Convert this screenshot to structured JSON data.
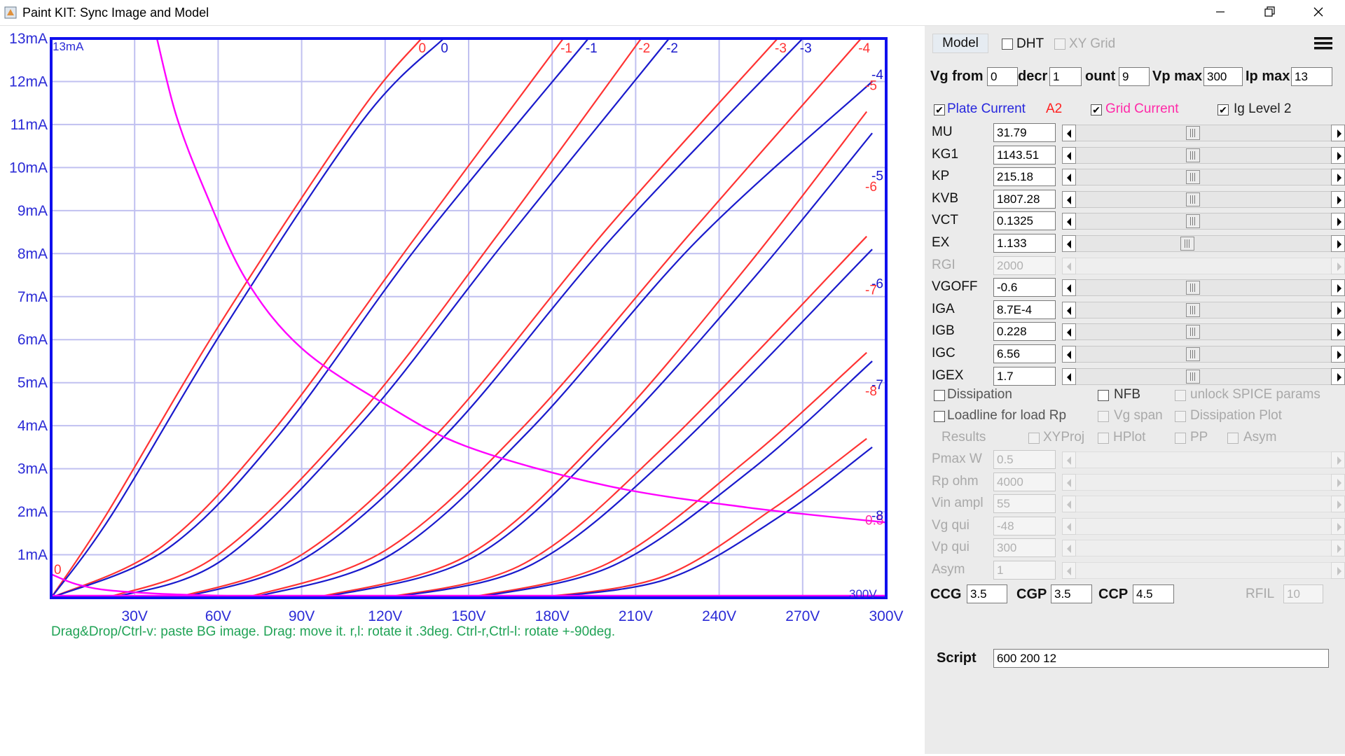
{
  "window": {
    "title": "Paint KIT: Sync Image and Model"
  },
  "chart_data": {
    "type": "line",
    "y_top_label": "13mA",
    "x_right_label": "300V",
    "x_range": [
      0,
      300
    ],
    "y_range": [
      0,
      13
    ],
    "x_ticks": [
      "30V",
      "60V",
      "90V",
      "120V",
      "150V",
      "180V",
      "210V",
      "240V",
      "270V",
      "300V"
    ],
    "y_ticks": [
      "1mA",
      "2mA",
      "3mA",
      "4mA",
      "5mA",
      "6mA",
      "7mA",
      "8mA",
      "9mA",
      "10mA",
      "11mA",
      "12mA",
      "13mA"
    ],
    "grid": true,
    "colors": {
      "plate_measured": "#ff3333",
      "plate_model": "#1a1acc",
      "grid_current": "#ff00ff",
      "frame": "#1010ee",
      "grid": "#c0c0f0"
    },
    "plate_curves": [
      {
        "vg": "0",
        "measured": [
          [
            0,
            0
          ],
          [
            20,
            1.95
          ],
          [
            60,
            6.3
          ],
          [
            110,
            11.2
          ],
          [
            133,
            13.0
          ]
        ],
        "model": [
          [
            0,
            0
          ],
          [
            22,
            1.95
          ],
          [
            62,
            6.25
          ],
          [
            112,
            11.1
          ],
          [
            141,
            13.0
          ]
        ]
      },
      {
        "vg": "-1",
        "measured": [
          [
            0,
            0
          ],
          [
            40,
            1.2
          ],
          [
            80,
            3.9
          ],
          [
            130,
            8.3
          ],
          [
            184,
            13.0
          ]
        ],
        "model": [
          [
            0,
            0
          ],
          [
            42,
            1.15
          ],
          [
            82,
            3.8
          ],
          [
            132,
            8.2
          ],
          [
            193,
            13.0
          ]
        ]
      },
      {
        "vg": "-2",
        "measured": [
          [
            20,
            0
          ],
          [
            60,
            1.0
          ],
          [
            110,
            4.2
          ],
          [
            160,
            8.4
          ],
          [
            212,
            13.0
          ]
        ],
        "model": [
          [
            22,
            0
          ],
          [
            62,
            0.9
          ],
          [
            112,
            4.1
          ],
          [
            162,
            8.2
          ],
          [
            222,
            13.0
          ]
        ]
      },
      {
        "vg": "-3",
        "measured": [
          [
            45,
            0
          ],
          [
            90,
            1.0
          ],
          [
            140,
            3.9
          ],
          [
            200,
            8.6
          ],
          [
            261,
            13.0
          ]
        ],
        "model": [
          [
            47,
            0
          ],
          [
            92,
            0.95
          ],
          [
            142,
            3.8
          ],
          [
            202,
            8.4
          ],
          [
            270,
            13.0
          ]
        ]
      },
      {
        "vg": "-4",
        "measured": [
          [
            70,
            0
          ],
          [
            120,
            1.1
          ],
          [
            170,
            4.0
          ],
          [
            230,
            8.5
          ],
          [
            291,
            13.0
          ]
        ],
        "model": [
          [
            72,
            0
          ],
          [
            122,
            1.0
          ],
          [
            172,
            3.9
          ],
          [
            232,
            8.3
          ],
          [
            295,
            12.0
          ]
        ]
      },
      {
        "vg": "-5",
        "measured": [
          [
            95,
            0
          ],
          [
            150,
            1.0
          ],
          [
            200,
            3.9
          ],
          [
            250,
            7.7
          ],
          [
            293,
            11.3
          ]
        ],
        "model": [
          [
            97,
            0
          ],
          [
            152,
            0.95
          ],
          [
            202,
            3.8
          ],
          [
            252,
            7.4
          ],
          [
            295,
            10.8
          ]
        ]
      },
      {
        "vg": "-6",
        "measured": [
          [
            120,
            0
          ],
          [
            170,
            0.8
          ],
          [
            220,
            3.5
          ],
          [
            293,
            8.4
          ]
        ],
        "model": [
          [
            122,
            0
          ],
          [
            172,
            0.75
          ],
          [
            222,
            3.3
          ],
          [
            295,
            8.1
          ]
        ]
      },
      {
        "vg": "-7",
        "measured": [
          [
            150,
            0
          ],
          [
            200,
            0.8
          ],
          [
            250,
            3.2
          ],
          [
            293,
            5.7
          ]
        ],
        "model": [
          [
            152,
            0
          ],
          [
            202,
            0.75
          ],
          [
            252,
            3.0
          ],
          [
            295,
            5.5
          ]
        ]
      },
      {
        "vg": "-8",
        "measured": [
          [
            175,
            0
          ],
          [
            220,
            0.5
          ],
          [
            260,
            2.1
          ],
          [
            293,
            3.7
          ]
        ],
        "model": [
          [
            177,
            0
          ],
          [
            222,
            0.45
          ],
          [
            262,
            1.9
          ],
          [
            295,
            3.5
          ]
        ]
      }
    ],
    "grid_current_curves": [
      {
        "label": "0",
        "points": [
          [
            0,
            0.55
          ],
          [
            10,
            0.3
          ],
          [
            25,
            0.15
          ],
          [
            60,
            0.05
          ],
          [
            120,
            0.02
          ],
          [
            300,
            0.01
          ]
        ]
      },
      {
        "label": "0.5",
        "points": [
          [
            38,
            13.0
          ],
          [
            45,
            11.2
          ],
          [
            55,
            9.5
          ],
          [
            70,
            7.4
          ],
          [
            90,
            5.8
          ],
          [
            120,
            4.5
          ],
          [
            150,
            3.5
          ],
          [
            200,
            2.6
          ],
          [
            250,
            2.1
          ],
          [
            300,
            1.75
          ]
        ]
      }
    ],
    "right_labels_measured": [
      {
        "label": "-5",
        "y": 11.9
      },
      {
        "label": "-6",
        "y": 9.55
      },
      {
        "label": "-7",
        "y": 7.15
      },
      {
        "label": "-8",
        "y": 4.8
      },
      {
        "label": "0.5",
        "y": 1.8
      }
    ],
    "right_labels_model": [
      {
        "label": "-4",
        "y": 12.15
      },
      {
        "label": "-5",
        "y": 9.8
      },
      {
        "label": "-6",
        "y": 7.3
      },
      {
        "label": "-7",
        "y": 4.95
      },
      {
        "label": "-8",
        "y": 1.9
      }
    ],
    "top_labels_measured": [
      {
        "label": "0",
        "x": 133
      },
      {
        "label": "-1",
        "x": 184
      },
      {
        "label": "-2",
        "x": 212
      },
      {
        "label": "-3",
        "x": 261
      },
      {
        "label": "-4",
        "x": 291
      }
    ],
    "top_labels_model": [
      {
        "label": "0",
        "x": 141
      },
      {
        "label": "-1",
        "x": 193
      },
      {
        "label": "-2",
        "x": 222
      },
      {
        "label": "-3",
        "x": 270
      }
    ],
    "zero_label": "0"
  },
  "hint": "Drag&Drop/Ctrl-v: paste BG image. Drag: move it. r,l: rotate it .3deg. Ctrl-r,Ctrl-l: rotate +-90deg.",
  "panel": {
    "model_button": "Model",
    "dht": {
      "label": "DHT",
      "checked": false
    },
    "xy_grid": {
      "label": "XY Grid",
      "checked": false
    },
    "vg_from": {
      "label": "Vg from",
      "value": "0"
    },
    "decr": {
      "label": "decr",
      "value": "1"
    },
    "count": {
      "label": "ount",
      "value": "9"
    },
    "vp_max": {
      "label": "Vp max",
      "value": "300"
    },
    "ip_max": {
      "label": "Ip max",
      "value": "13"
    },
    "plate_current": {
      "label": "Plate Current",
      "checked": true
    },
    "a2": "A2",
    "grid_current": {
      "label": "Grid Current",
      "checked": true
    },
    "ig_level": {
      "label": "Ig Level 2",
      "checked": true
    },
    "params": [
      {
        "name": "MU",
        "value": "31.79",
        "enabled": true,
        "pos": 0.43
      },
      {
        "name": "KG1",
        "value": "1143.51",
        "enabled": true,
        "pos": 0.43
      },
      {
        "name": "KP",
        "value": "215.18",
        "enabled": true,
        "pos": 0.43
      },
      {
        "name": "KVB",
        "value": "1807.28",
        "enabled": true,
        "pos": 0.43
      },
      {
        "name": "VCT",
        "value": "0.1325",
        "enabled": true,
        "pos": 0.43
      },
      {
        "name": "EX",
        "value": "1.133",
        "enabled": true,
        "pos": 0.41
      },
      {
        "name": "RGI",
        "value": "2000",
        "enabled": false,
        "pos": null
      },
      {
        "name": "VGOFF",
        "value": "-0.6",
        "enabled": true,
        "pos": 0.43
      },
      {
        "name": "IGA",
        "value": "8.7E-4",
        "enabled": true,
        "pos": 0.43
      },
      {
        "name": "IGB",
        "value": "0.228",
        "enabled": true,
        "pos": 0.43
      },
      {
        "name": "IGC",
        "value": "6.56",
        "enabled": true,
        "pos": 0.43
      },
      {
        "name": "IGEX",
        "value": "1.7",
        "enabled": true,
        "pos": 0.43
      }
    ],
    "dissipation": {
      "label": "Dissipation",
      "checked": false
    },
    "nfb": {
      "label": "NFB",
      "checked": false
    },
    "unlock_spice": {
      "label": "unlock SPICE params",
      "checked": false
    },
    "loadline": {
      "label": "Loadline for load Rp",
      "checked": false
    },
    "vg_span": {
      "label": "Vg span",
      "checked": false
    },
    "dissipation_plot": {
      "label": "Dissipation Plot",
      "checked": false
    },
    "results": "Results",
    "xyproj": {
      "label": "XYProj",
      "checked": false
    },
    "hplot": {
      "label": "HPlot",
      "checked": false
    },
    "pp": {
      "label": "PP",
      "checked": false
    },
    "asym_cb": {
      "label": "Asym",
      "checked": false
    },
    "load_params": [
      {
        "name": "Pmax W",
        "value": "0.5"
      },
      {
        "name": "Rp ohm",
        "value": "4000"
      },
      {
        "name": "Vin ampl",
        "value": "55"
      },
      {
        "name": "Vg qui",
        "value": "-48"
      },
      {
        "name": "Vp qui",
        "value": "300"
      },
      {
        "name": "Asym",
        "value": "1"
      }
    ],
    "ccg": {
      "label": "CCG",
      "value": "3.5"
    },
    "cgp": {
      "label": "CGP",
      "value": "3.5"
    },
    "ccp": {
      "label": "CCP",
      "value": "4.5"
    },
    "rfil": {
      "label": "RFIL",
      "value": "10"
    },
    "script": {
      "label": "Script",
      "value": "600 200 12"
    }
  }
}
